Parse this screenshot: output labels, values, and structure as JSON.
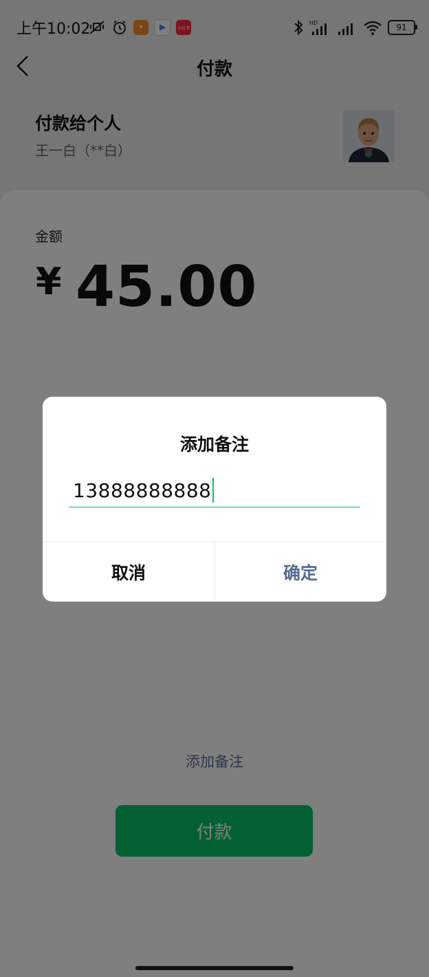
{
  "status_bar": {
    "time": "上午10:02",
    "battery": "91",
    "icons_left": [
      "mute-vibrate-icon",
      "alarm-icon",
      "app-icon-orange",
      "app-icon-play",
      "app-icon-red"
    ],
    "icons_right": [
      "bluetooth-icon",
      "hd-signal-icon",
      "signal-icon",
      "wifi-icon",
      "battery-icon"
    ],
    "red_app_label": "小红书"
  },
  "header": {
    "title": "付款",
    "back_icon": "chevron-left-icon"
  },
  "payee": {
    "label": "付款给个人",
    "name": "王一白（**白）"
  },
  "amount": {
    "label": "金额",
    "currency_symbol": "¥",
    "value": "45.00"
  },
  "add_note_link": "添加备注",
  "pay_button": "付款",
  "dialog": {
    "title": "添加备注",
    "input_value": "13888888888",
    "cancel_label": "取消",
    "ok_label": "确定"
  },
  "colors": {
    "accent_green": "#07c160",
    "link_blue": "#576b95"
  }
}
